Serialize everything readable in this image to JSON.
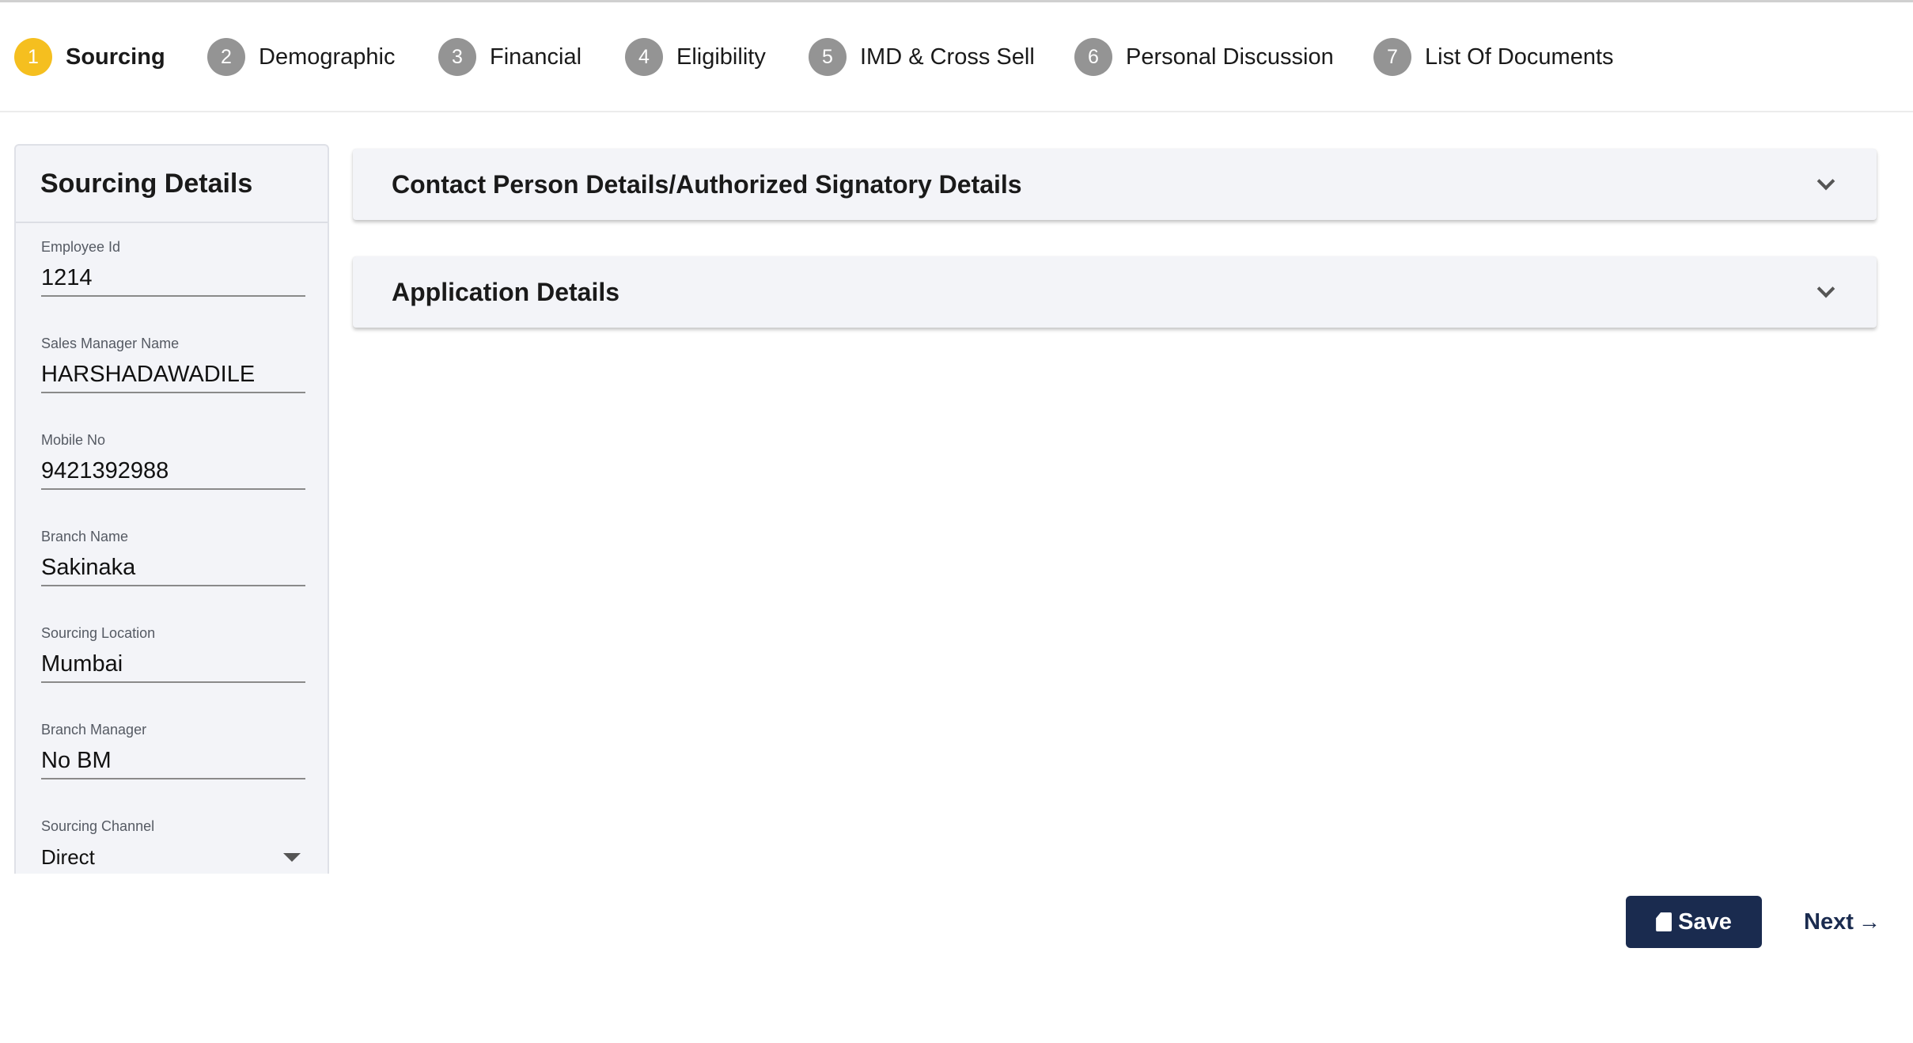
{
  "stepper": {
    "steps": [
      {
        "number": "1",
        "label": "Sourcing",
        "active": true
      },
      {
        "number": "2",
        "label": "Demographic"
      },
      {
        "number": "3",
        "label": "Financial"
      },
      {
        "number": "4",
        "label": "Eligibility"
      },
      {
        "number": "5",
        "label": "IMD & Cross Sell"
      },
      {
        "number": "6",
        "label": "Personal Discussion"
      },
      {
        "number": "7",
        "label": "List Of Documents"
      }
    ],
    "active_color": "#f5bf1f",
    "inactive_color": "#949494"
  },
  "sourcing_panel": {
    "title": "Sourcing Details",
    "fields": [
      {
        "label": "Employee Id",
        "value": "1214"
      },
      {
        "label": "Sales Manager Name",
        "value": "HARSHADAWADILE"
      },
      {
        "label": "Mobile No",
        "value": "9421392988"
      },
      {
        "label": "Branch Name",
        "value": "Sakinaka"
      },
      {
        "label": "Sourcing Location",
        "value": "Mumbai"
      },
      {
        "label": "Branch Manager",
        "value": "No BM"
      },
      {
        "label": "Sourcing Channel",
        "value": "Direct"
      }
    ]
  },
  "accordions": [
    {
      "title": "Contact Person Details/Authorized Signatory Details",
      "icon": "chevron-down-icon"
    },
    {
      "title": "Application Details",
      "icon": "chevron-down-icon"
    }
  ],
  "footer": {
    "save_label": "Save",
    "save_icon": "sd-card-icon",
    "next_label": "Next",
    "next_icon": "→",
    "primary_color": "#1a2b4f"
  }
}
